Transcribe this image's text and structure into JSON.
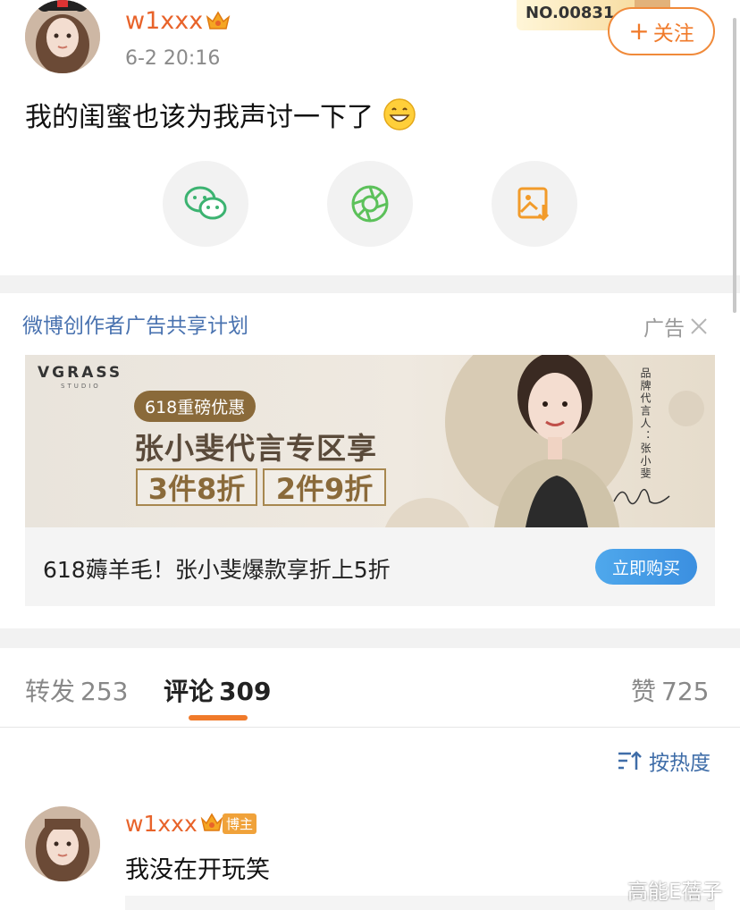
{
  "post": {
    "username": "w1xxx",
    "time": "6-2 20:16",
    "badge_number": "NO.00831",
    "follow_label": "关注",
    "text": "我的闺蜜也该为我声讨一下了"
  },
  "share_buttons": [
    "wechat-icon",
    "moments-icon",
    "save-image-icon"
  ],
  "ad": {
    "title": "微博创作者广告共享计划",
    "tag": "广告",
    "banner": {
      "brand": "VGRASS",
      "studio": "STUDIO",
      "promo_pill": "618重磅优惠",
      "headline": "张小斐代言专区享",
      "deal_1": "3件8折",
      "deal_2": "2件9折",
      "vertical_text": "品牌代言人：张小斐"
    },
    "footer_text": "618薅羊毛！张小斐爆款享折上5折",
    "buy_label": "立即购买"
  },
  "tabs": [
    {
      "label": "转发",
      "count": "253"
    },
    {
      "label": "评论",
      "count": "309"
    },
    {
      "label": "赞",
      "count": "725"
    }
  ],
  "sort_label": "按热度",
  "comment": {
    "username": "w1xxx",
    "badge": "博主",
    "text": "我没在开玩笑"
  },
  "watermark": "高能E蓓子",
  "colors": {
    "brand_orange": "#e8632a",
    "link_blue": "#4a73b0",
    "buy_blue": "#3b8fe0"
  }
}
